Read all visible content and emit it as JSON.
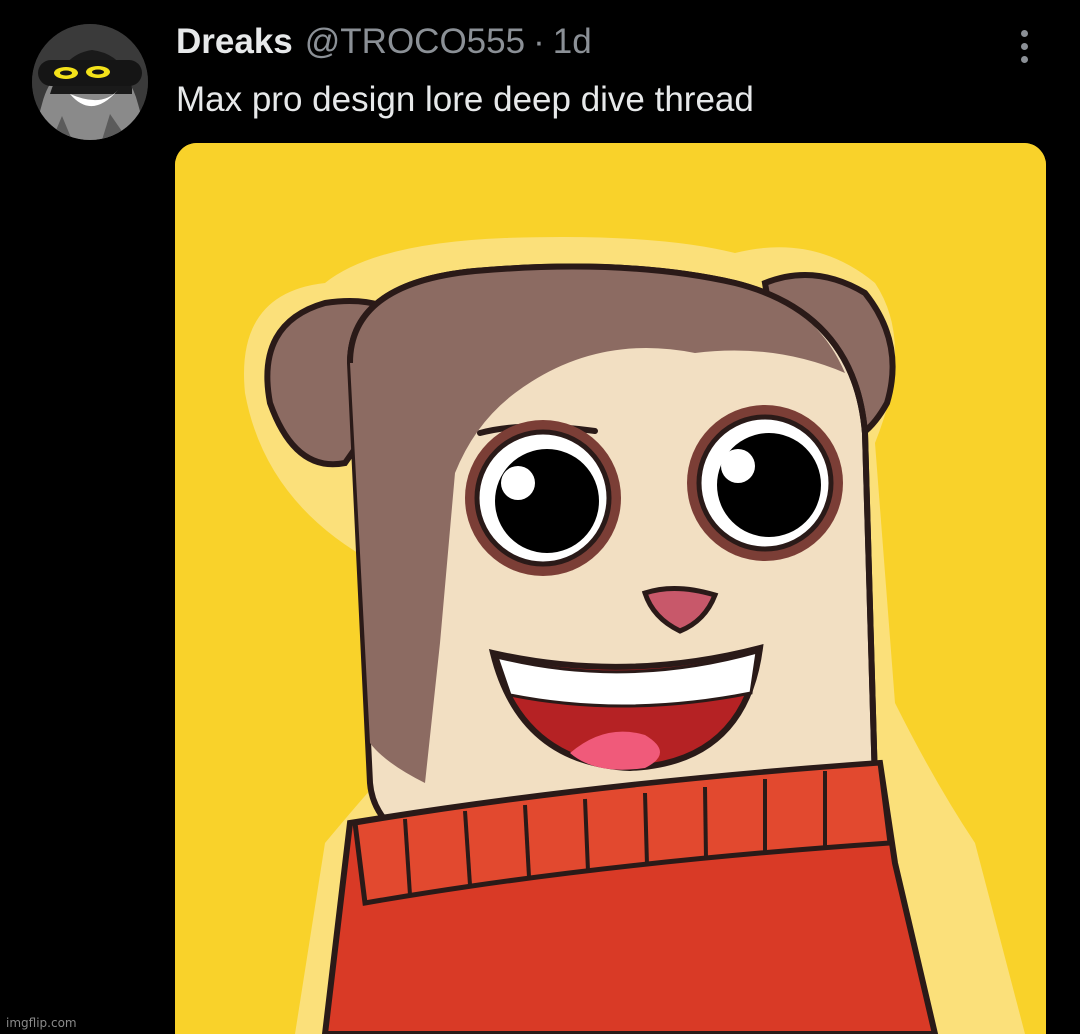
{
  "post": {
    "display_name": "Dreaks",
    "handle": "@TROCO555",
    "separator": "·",
    "time": "1d",
    "text": "Max pro design lore deep dive thread"
  },
  "icons": {
    "avatar": "masked-cartoon-avatar",
    "more": "vertical-ellipsis-icon"
  },
  "media": {
    "subject": "cartoon brown-and-cream bear in red turtleneck on yellow background"
  },
  "watermark": "imgflip.com",
  "colors": {
    "background": "#000000",
    "primary_text": "#e7e9ea",
    "secondary_text": "#8b9096",
    "media_background": "#f9d22a",
    "sweater": "#d93a26"
  }
}
